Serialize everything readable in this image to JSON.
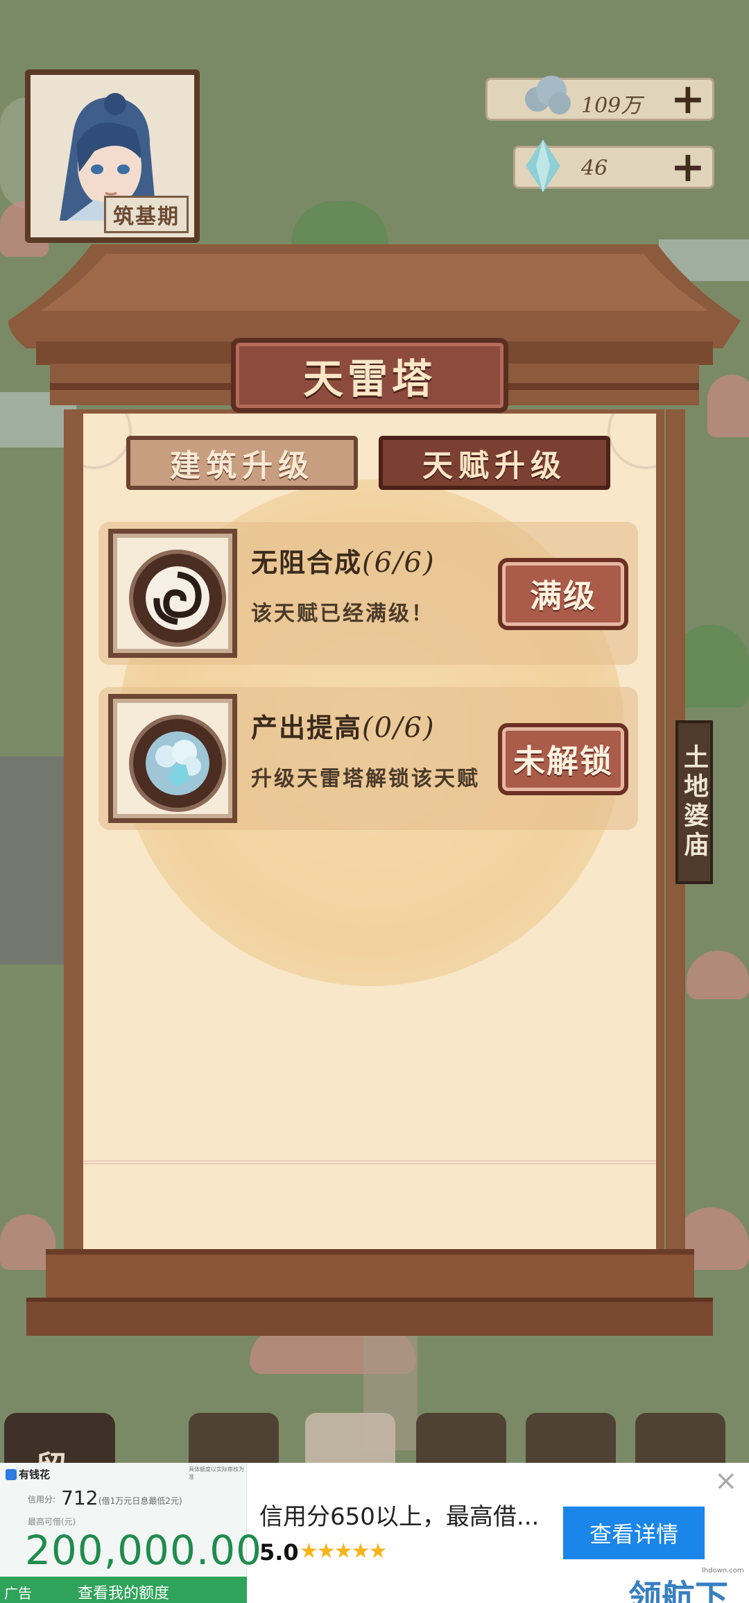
{
  "player": {
    "name": "筑基期",
    "avatar_icon": "cultivator-portrait"
  },
  "resources": [
    {
      "value": "109万",
      "icon": "cloud-icon",
      "action": "+"
    },
    {
      "value": "46",
      "icon": "crystal-icon",
      "action": "+"
    }
  ],
  "panel": {
    "title": "天雷塔",
    "tabs": [
      {
        "label": "建筑升级",
        "active": false
      },
      {
        "label": "天赋升级",
        "active": true
      }
    ],
    "talents": [
      {
        "name": "无阻合成",
        "progress": "(6/6)",
        "description": "该天赋已经满级！",
        "button": "满级",
        "icon": "swirl-icon"
      },
      {
        "name": "产出提高",
        "progress": "(0/6)",
        "description": "升级天雷塔解锁该天赋",
        "button": "未解锁",
        "icon": "crystal-cloud-icon"
      }
    ]
  },
  "map": {
    "side_sign": "土地婆庙",
    "corner_button": "留"
  },
  "ad": {
    "brand": "有钱花",
    "fine_print": "具体额度以实际审核为准",
    "credit_label": "信用分:",
    "credit_value": "712",
    "credit_note": "(借1万元日息最低2元)",
    "max_label": "最高可借(元)",
    "amount": "200,000.00",
    "ad_tag": "广告",
    "check_label": "查看我的额度",
    "headline": "信用分650以上，最高借...",
    "rating": "5.0",
    "stars": "★★★★★",
    "cta": "查看详情",
    "close": "×",
    "watermark": "领航下载",
    "watermark_small": "lhdown.com"
  },
  "colors": {
    "accent": "#8c4b3d",
    "paper": "#f8e7c8",
    "wood": "#8c5a3c",
    "cta": "#1a86ea",
    "amount": "#1f8c4d"
  }
}
